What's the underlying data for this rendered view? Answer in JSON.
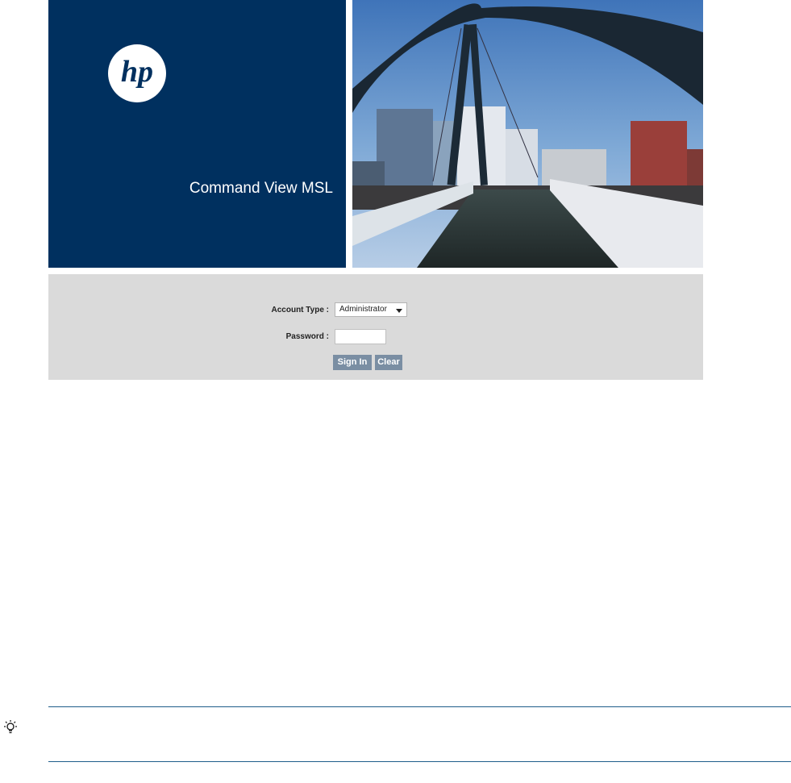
{
  "brand": {
    "logo_text": "hp",
    "product_name": "Command View MSL",
    "background_color": "#00305f"
  },
  "photo": {
    "icon": "bridge-photo"
  },
  "login": {
    "account_type_label": "Account Type :",
    "account_type_value": "Administrator",
    "password_label": "Password :",
    "password_value": "",
    "signin_label": "Sign In",
    "clear_label": "Clear",
    "button_color": "#7a8ea3",
    "panel_color": "#dadada"
  },
  "tip": {
    "icon": "lightbulb-icon",
    "rule_color": "#1f5d8a"
  }
}
